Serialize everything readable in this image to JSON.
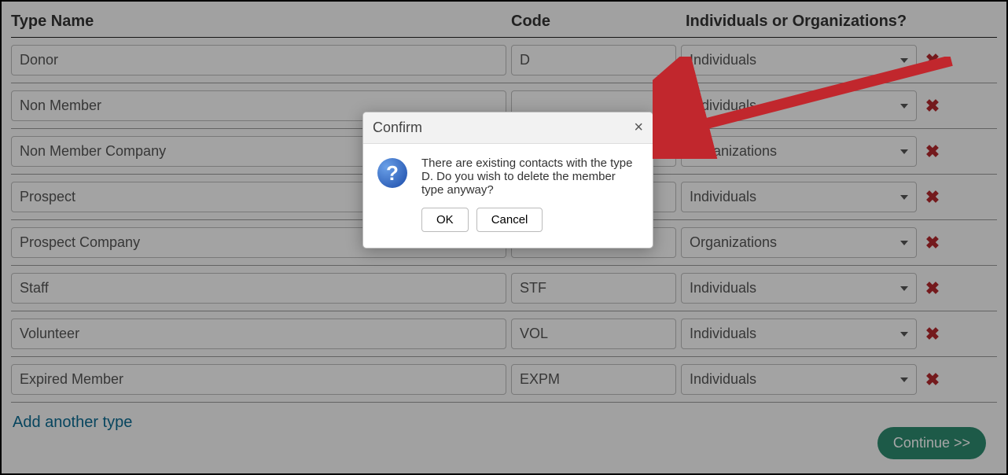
{
  "headers": {
    "name": "Type Name",
    "code": "Code",
    "category": "Individuals or Organizations?"
  },
  "rows": [
    {
      "name": "Donor",
      "code": "D",
      "category": "Individuals"
    },
    {
      "name": "Non Member",
      "code": "",
      "category": "Individuals"
    },
    {
      "name": "Non Member Company",
      "code": "",
      "category": "Organizations"
    },
    {
      "name": "Prospect",
      "code": "",
      "category": "Individuals"
    },
    {
      "name": "Prospect Company",
      "code": "",
      "category": "Organizations"
    },
    {
      "name": "Staff",
      "code": "STF",
      "category": "Individuals"
    },
    {
      "name": "Volunteer",
      "code": "VOL",
      "category": "Individuals"
    },
    {
      "name": "Expired Member",
      "code": "EXPM",
      "category": "Individuals"
    }
  ],
  "addLink": "Add another type",
  "continueLabel": "Continue >>",
  "dialog": {
    "title": "Confirm",
    "message": "There are existing contacts with the type D. Do you wish to delete the member type anyway?",
    "ok": "OK",
    "cancel": "Cancel"
  }
}
